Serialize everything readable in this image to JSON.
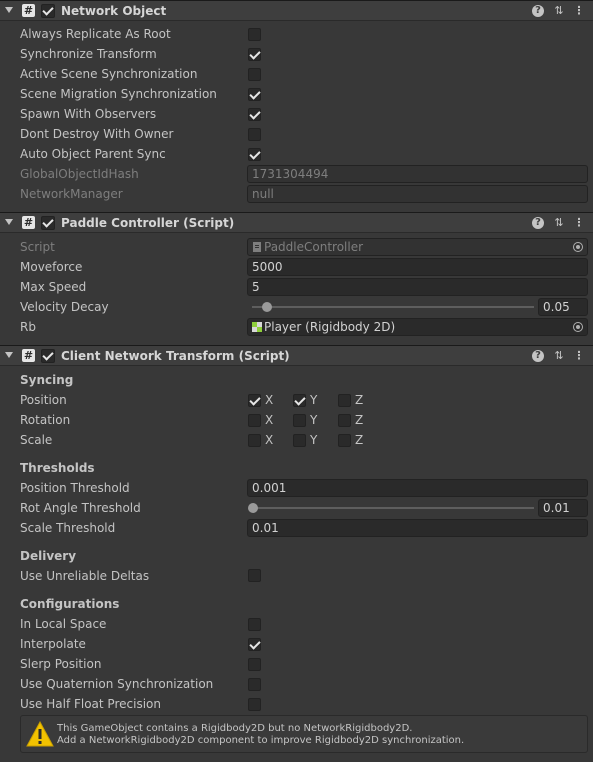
{
  "network_object": {
    "title": "Network Object",
    "rows": [
      {
        "label": "Always Replicate As Root",
        "checked": false
      },
      {
        "label": "Synchronize Transform",
        "checked": true
      },
      {
        "label": "Active Scene Synchronization",
        "checked": false
      },
      {
        "label": "Scene Migration Synchronization",
        "checked": true
      },
      {
        "label": "Spawn With Observers",
        "checked": true
      },
      {
        "label": "Dont Destroy With Owner",
        "checked": false
      },
      {
        "label": "Auto Object Parent Sync",
        "checked": true
      }
    ],
    "global_hash_label": "GlobalObjectIdHash",
    "global_hash_value": "1731304494",
    "network_manager_label": "NetworkManager",
    "network_manager_value": "null"
  },
  "paddle_controller": {
    "title": "Paddle Controller (Script)",
    "script_label": "Script",
    "script_value": "PaddleController",
    "moveforce_label": "Moveforce",
    "moveforce_value": "5000",
    "max_speed_label": "Max Speed",
    "max_speed_value": "5",
    "velocity_decay_label": "Velocity Decay",
    "velocity_decay_value": "0.05",
    "rb_label": "Rb",
    "rb_value": "Player (Rigidbody 2D)"
  },
  "client_network_transform": {
    "title": "Client Network Transform (Script)",
    "syncing_header": "Syncing",
    "axes": {
      "x": "X",
      "y": "Y",
      "z": "Z"
    },
    "sync_rows": [
      {
        "label": "Position",
        "x": true,
        "y": true,
        "z": false
      },
      {
        "label": "Rotation",
        "x": false,
        "y": false,
        "z": false
      },
      {
        "label": "Scale",
        "x": false,
        "y": false,
        "z": false
      }
    ],
    "thresholds_header": "Thresholds",
    "position_threshold_label": "Position Threshold",
    "position_threshold_value": "0.001",
    "rot_angle_threshold_label": "Rot Angle Threshold",
    "rot_angle_threshold_value": "0.01",
    "scale_threshold_label": "Scale Threshold",
    "scale_threshold_value": "0.01",
    "delivery_header": "Delivery",
    "use_unreliable_deltas_label": "Use Unreliable Deltas",
    "use_unreliable_deltas_checked": false,
    "configurations_header": "Configurations",
    "config_rows": [
      {
        "label": "In Local Space",
        "checked": false
      },
      {
        "label": "Interpolate",
        "checked": true
      },
      {
        "label": "Slerp Position",
        "checked": false
      },
      {
        "label": "Use Quaternion Synchronization",
        "checked": false
      },
      {
        "label": "Use Half Float Precision",
        "checked": false
      }
    ],
    "warning_line1": "This GameObject contains a Rigidbody2D but no NetworkRigidbody2D.",
    "warning_line2": "Add a NetworkRigidbody2D component to improve Rigidbody2D synchronization."
  },
  "header_icons": {
    "help": "help-icon",
    "preset": "preset-icon",
    "menu": "kebab-menu-icon",
    "script": "script-hash-icon"
  },
  "colors": {
    "background": "#383838",
    "header": "#3e3e3e",
    "field": "#2a2a2a",
    "warning": "#f2c200",
    "rb_icon": "#8fcf3a"
  }
}
